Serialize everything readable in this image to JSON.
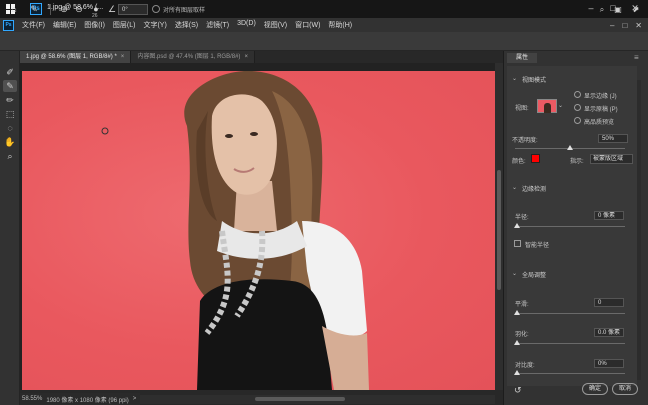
{
  "window": {
    "taskbar_title": "1.jpg @ 58.6% (...",
    "buttons": [
      "–",
      "□",
      "✕"
    ]
  },
  "menu": {
    "items": [
      "文件(F)",
      "编辑(E)",
      "图像(I)",
      "图层(L)",
      "文字(Y)",
      "选择(S)",
      "滤镜(T)",
      "3D(D)",
      "视图(V)",
      "窗口(W)",
      "帮助(H)"
    ],
    "window_buttons": [
      "–",
      "□",
      "✕"
    ]
  },
  "options": {
    "brush_size": "26",
    "angle_value": "0°",
    "sample_label": "对所有图层取样"
  },
  "tabs": [
    {
      "label": "1.jpg @ 58.6% (图层 1, RGB/8#) *",
      "active": true
    },
    {
      "label": "内容图.psd @ 47.4% (图层 1, RGB/8#)",
      "active": false
    }
  ],
  "status": {
    "zoom": "58.55%",
    "info": "1980 像素 x 1080 像素 (96 ppi)",
    "arrow": ">"
  },
  "panel": {
    "tab": "属性",
    "menu_icon": "≡",
    "view_mode_heading": "视图模式",
    "view_label": "视图:",
    "show_edge": "显示边缘 (J)",
    "show_original": "显示原稿 (P)",
    "high_quality_preview": "高品质预览",
    "opacity_label": "不透明度:",
    "opacity_value": "50%",
    "opacity_level": 0.5,
    "color_label": "颜色:",
    "color": "#ff0000",
    "indicates_label": "指示:",
    "indicates_value": "被蒙版区域",
    "edge_detection_heading": "边缘检测",
    "radius_label": "半径:",
    "radius_value": "0 像素",
    "smart_radius_label": "智能半径",
    "global_refinements_heading": "全局调整",
    "smooth_label": "平滑:",
    "smooth_value": "0",
    "feather_label": "羽化:",
    "feather_value": "0.0 像素",
    "contrast_label": "对比度:",
    "contrast_value": "0%",
    "ok_label": "确定",
    "cancel_label": "取消"
  }
}
